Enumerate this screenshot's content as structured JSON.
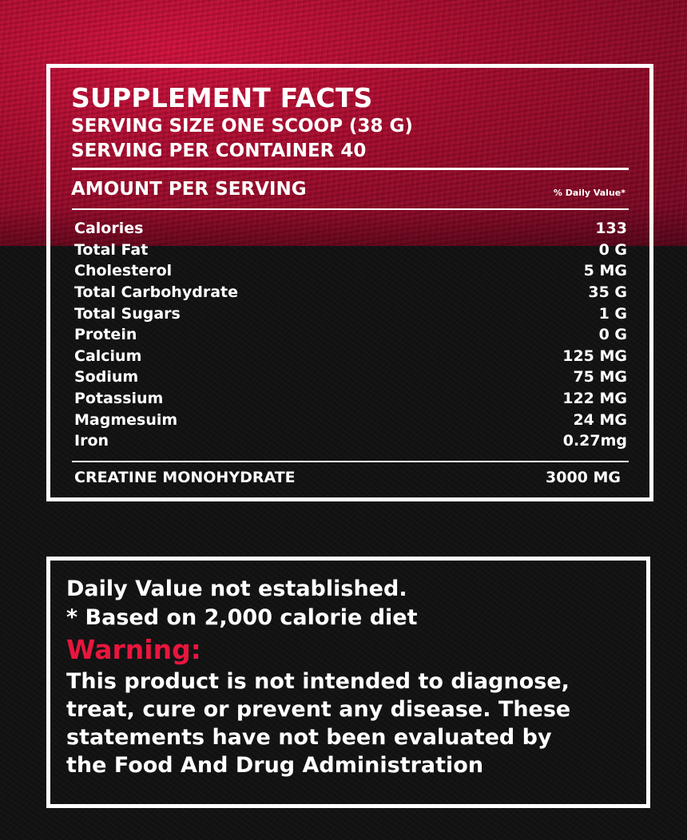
{
  "colors": {
    "top_band": "#b00c30",
    "background": "#111112",
    "text": "#ffffff",
    "warning": "#e8163d"
  },
  "facts": {
    "title": "SUPPLEMENT FACTS",
    "serving_size": "SERVING SIZE ONE SCOOP (38 G)",
    "servings_per_container": "SERVING PER CONTAINER 40",
    "amount_heading": "AMOUNT PER SERVING",
    "daily_value_heading": "% Daily Value*",
    "nutrients": [
      {
        "name": "Calories",
        "amount": "133"
      },
      {
        "name": "Total Fat",
        "amount": "0 G"
      },
      {
        "name": "Cholesterol",
        "amount": "5 MG"
      },
      {
        "name": "Total Carbohydrate",
        "amount": "35 G"
      },
      {
        "name": "Total Sugars",
        "amount": "1 G"
      },
      {
        "name": "Protein",
        "amount": "0 G"
      },
      {
        "name": "Calcium",
        "amount": "125 MG"
      },
      {
        "name": "Sodium",
        "amount": "75 MG"
      },
      {
        "name": "Potassium",
        "amount": "122 MG"
      },
      {
        "name": "Magmesuim",
        "amount": "24 MG"
      },
      {
        "name": "Iron",
        "amount": "0.27mg"
      }
    ],
    "creatine": {
      "name": "CREATINE MONOHYDRATE",
      "amount": "3000 MG"
    }
  },
  "info": {
    "line1": "Daily Value not established.",
    "line2": "* Based on 2,000 calorie diet",
    "warning_label": "Warning:",
    "disclaimer_lines": [
      "This product is not intended to diagnose,",
      "treat, cure or prevent any disease.  These",
      "statements have not been evaluated by",
      "the Food And Drug Administration"
    ]
  }
}
